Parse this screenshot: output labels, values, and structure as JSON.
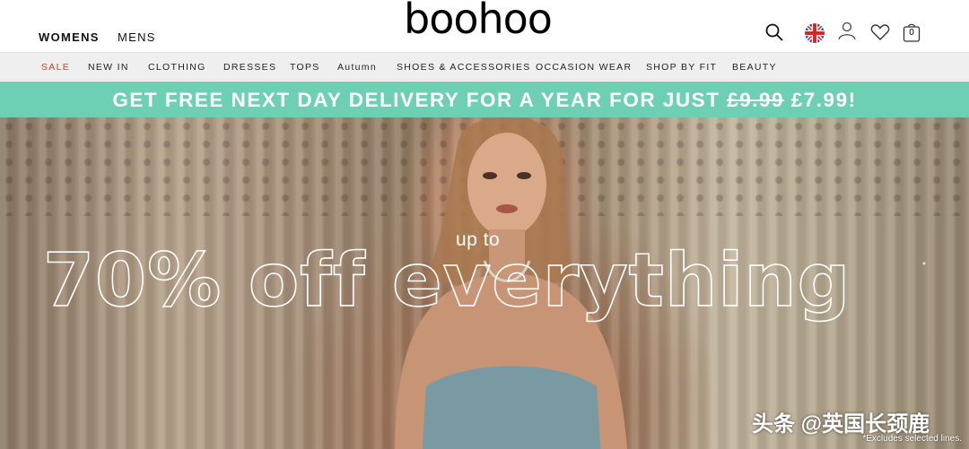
{
  "header": {
    "gender_tabs": [
      "WOMENS",
      "MENS"
    ],
    "logo": "boohoo",
    "bag_count": "0"
  },
  "icons": [
    "search-icon",
    "uk-flag-icon",
    "account-icon",
    "heart-icon",
    "bag-icon"
  ],
  "nav": {
    "categories": [
      "SALE",
      "NEW IN",
      "CLOTHING",
      "DRESSES",
      "TOPS",
      "Autumn",
      "SHOES & ACCESSORIES",
      "OCCASION WEAR",
      "SHOP BY FIT",
      "BEAUTY"
    ]
  },
  "promo": {
    "text": "GET FREE NEXT DAY DELIVERY FOR A YEAR FOR JUST",
    "old_price": "£9.99",
    "new_price": "£7.99!"
  },
  "hero": {
    "kicker": "up to",
    "headline": "70% off everything",
    "asterisk": "*",
    "footnote": "*Excludes selected lines."
  },
  "watermark": "头条 @英国长颈鹿",
  "colors": {
    "promo_bg": "#6dcfb3",
    "sale_red": "#e6322b",
    "nav_bg": "#efefef"
  }
}
